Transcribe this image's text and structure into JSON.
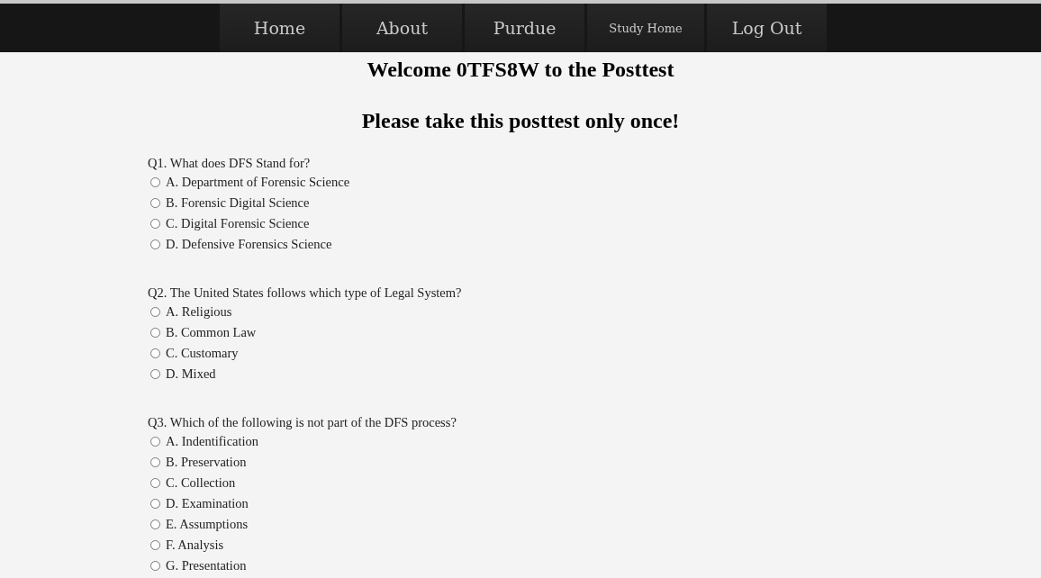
{
  "nav": [
    {
      "label": "Home",
      "small": false
    },
    {
      "label": "About",
      "small": false
    },
    {
      "label": "Purdue",
      "small": false
    },
    {
      "label": "Study Home",
      "small": true
    },
    {
      "label": "Log Out",
      "small": false
    }
  ],
  "headings": [
    "Welcome 0TFS8W to the Posttest",
    "Please take this posttest only once!"
  ],
  "questions": [
    {
      "text": "Q1. What does DFS Stand for?",
      "options": [
        {
          "label": "A. Department of Forensic Science",
          "selected": false
        },
        {
          "label": "B. Forensic Digital Science",
          "selected": false
        },
        {
          "label": "C. Digital Forensic Science",
          "selected": false
        },
        {
          "label": "D. Defensive Forensics Science",
          "selected": false
        }
      ]
    },
    {
      "text": "Q2. The United States follows which type of Legal System?",
      "options": [
        {
          "label": "A. Religious",
          "selected": false
        },
        {
          "label": "B. Common Law",
          "selected": false
        },
        {
          "label": "C. Customary",
          "selected": false
        },
        {
          "label": "D. Mixed",
          "selected": false
        }
      ]
    },
    {
      "text": "Q3. Which of the following is not part of the DFS process?",
      "options": [
        {
          "label": "A. Indentification",
          "selected": false
        },
        {
          "label": "B. Preservation",
          "selected": false
        },
        {
          "label": "C. Collection",
          "selected": false
        },
        {
          "label": "D. Examination",
          "selected": false
        },
        {
          "label": "E. Assumptions",
          "selected": false
        },
        {
          "label": "F. Analysis",
          "selected": false
        },
        {
          "label": "G. Presentation",
          "selected": false
        }
      ]
    }
  ]
}
